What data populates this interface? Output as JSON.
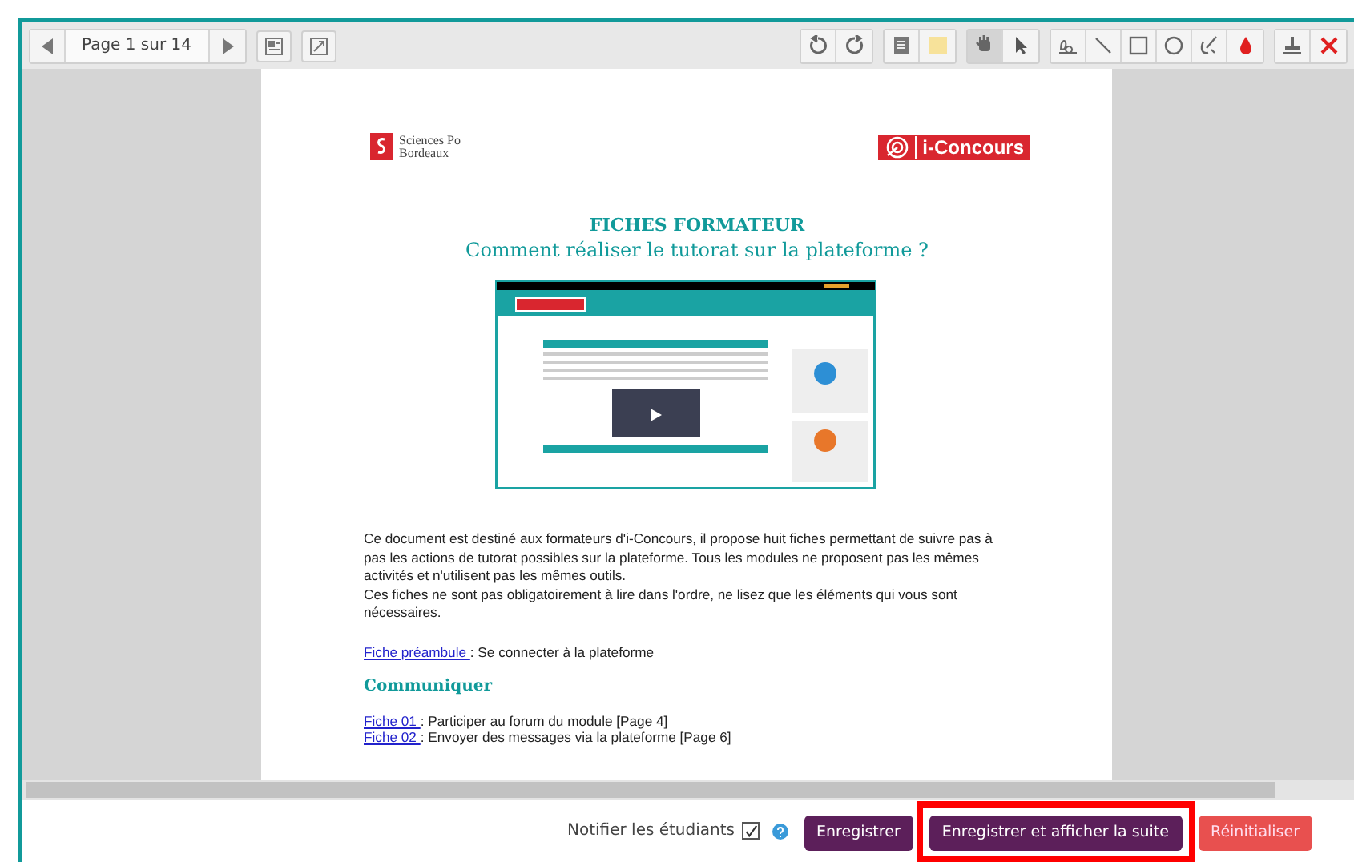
{
  "toolbar": {
    "nav": [
      {
        "kind": "prev"
      },
      {
        "kind": "page",
        "text": "Page 1 sur 14"
      },
      {
        "kind": "next"
      }
    ],
    "view_tools": [
      {
        "kind": "thumbnails"
      },
      {
        "kind": "fit"
      }
    ],
    "tool_groups": [
      {
        "tools": [
          {
            "kind": "rotate-left",
            "selected": false
          },
          {
            "kind": "rotate-right",
            "selected": false
          }
        ]
      },
      {
        "tools": [
          {
            "kind": "note",
            "selected": false
          },
          {
            "kind": "highlight",
            "selected": false
          }
        ]
      },
      {
        "tools": [
          {
            "kind": "hand",
            "selected": true
          },
          {
            "kind": "pointer",
            "selected": false
          }
        ]
      },
      {
        "tools": [
          {
            "kind": "signature",
            "selected": false
          },
          {
            "kind": "line",
            "selected": false
          },
          {
            "kind": "rectangle",
            "selected": false
          },
          {
            "kind": "circle",
            "selected": false
          },
          {
            "kind": "pen",
            "selected": false
          },
          {
            "kind": "ink",
            "selected": false
          }
        ]
      },
      {
        "tools": [
          {
            "kind": "stamp",
            "selected": false
          },
          {
            "kind": "delete",
            "selected": false
          }
        ]
      }
    ]
  },
  "document": {
    "logo_left": [
      "Sciences Po",
      "Bordeaux"
    ],
    "logo_right": "i-Concours",
    "title": "FICHES FORMATEUR",
    "subtitle": "Comment réaliser le tutorat sur la plateforme ?",
    "paragraphs": [
      "Ce document est destiné aux formateurs d'i-Concours, il propose huit fiches permettant de suivre pas à pas les actions de tutorat possibles sur la plateforme. Tous les modules ne proposent pas les mêmes activités et n'utilisent pas les mêmes outils.",
      "Ces fiches ne sont pas obligatoirement à lire dans l'ordre, ne lisez que les éléments qui vous sont nécessaires."
    ],
    "intro_link": {
      "link": "Fiche préambule ",
      "text": ": Se connecter à la plateforme"
    },
    "section": "Communiquer",
    "fiches": [
      {
        "link": "Fiche 01 ",
        "text": ": Participer au forum du module [Page 4]"
      },
      {
        "link": "Fiche 02 ",
        "text": ": Envoyer des messages via la plateforme [Page 6]"
      }
    ]
  },
  "footer": {
    "notify": {
      "label": "Notifier les étudiants",
      "checked": true
    },
    "buttons": [
      {
        "label": "Enregistrer",
        "kind": "primary",
        "highlighted": false
      },
      {
        "label": "Enregistrer et afficher la suite",
        "kind": "primary",
        "highlighted": true
      },
      {
        "label": "Réinitialiser",
        "kind": "danger",
        "highlighted": false
      }
    ]
  }
}
